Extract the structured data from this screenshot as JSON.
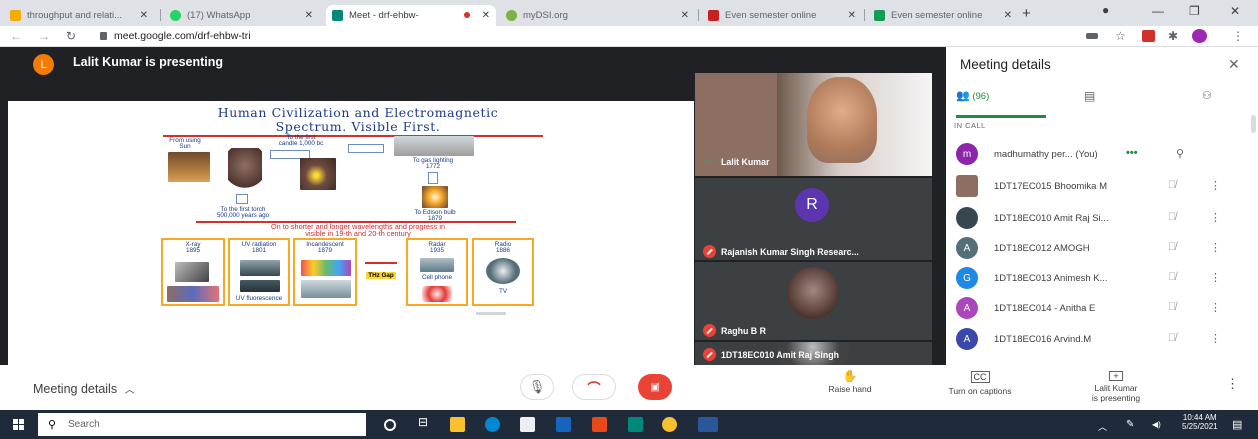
{
  "browser": {
    "tabs": [
      {
        "title": "throughput and relati...",
        "fav_color": "#f9ab00"
      },
      {
        "title": "(17) WhatsApp",
        "fav_color": "#25d366"
      },
      {
        "title": "Meet - drf-ehbw-",
        "fav_color": "#00897b"
      },
      {
        "title": "myDSI.org",
        "fav_color": "#7cb342"
      },
      {
        "title": "Even semester online",
        "fav_color": "#c5221f"
      },
      {
        "title": "Even semester online",
        "fav_color": "#0f9d58"
      }
    ],
    "url": "meet.google.com/drf-ehbw-tri"
  },
  "meet": {
    "presenter_initial": "L",
    "presenting_text": "Lalit Kumar is presenting"
  },
  "slide": {
    "title_line1": "Human Civilization and Electromagnetic",
    "title_line2": "Spectrum. Visible First.",
    "from_using": "From using",
    "sun": "Sun",
    "to_first_candle": "To the first",
    "candle_year": "candle 1,000 bc",
    "gas_lighting": "To gas lighting",
    "gas_year": "1772",
    "first_torch": "To the first torch",
    "torch_year": "500,000 years ago",
    "edison": "To Edison bulb",
    "edison_year": "1879",
    "wave_line1": "On to shorter and longer wavelengths and progress in",
    "wave_line2": "visible in 19-th and 20-th century",
    "box1": [
      "X-ray",
      "1895"
    ],
    "box2": [
      "UV radiation",
      "1801"
    ],
    "box3": [
      "Incandescent",
      "1879"
    ],
    "box4": [
      "Radar",
      "1935"
    ],
    "box5": [
      "Radio",
      "1886"
    ],
    "thz": "THz Gap",
    "cell_phone": "Cell phone",
    "uv_fluor": "UV fluorescence",
    "tv": "TV"
  },
  "tiles": [
    {
      "name": "Lalit Kumar",
      "speaking": true
    },
    {
      "name": "Rajanish Kumar Singh Researc...",
      "initial": "R",
      "avatar_color": "#5e35b1"
    },
    {
      "name": "Raghu B R"
    },
    {
      "name": "1DT18EC010 Amit Raj Singh"
    }
  ],
  "panel": {
    "title": "Meeting details",
    "people_count": "(96)",
    "in_call_label": "IN CALL",
    "participants": [
      {
        "initial": "m",
        "name": "madhumathy per... (You)",
        "color": "#8e24aa",
        "you": true
      },
      {
        "initial": "",
        "name": "1DT17EC015 Bhoomika M",
        "color": "#8d6e63"
      },
      {
        "initial": "",
        "name": "1DT18EC010 Amit Raj Si...",
        "color": "#37474f"
      },
      {
        "initial": "A",
        "name": "1DT18EC012 AMOGH",
        "color": "#546e7a"
      },
      {
        "initial": "G",
        "name": "1DT18EC013 Animesh K...",
        "color": "#1e88e5"
      },
      {
        "initial": "A",
        "name": "1DT18EC014 - Anitha E",
        "color": "#ab47bc"
      },
      {
        "initial": "A",
        "name": "1DT18EC016 Arvind.M",
        "color": "#3949ab"
      }
    ]
  },
  "bottombar": {
    "meeting_details": "Meeting details",
    "raise_hand": "Raise hand",
    "captions": "Turn on captions",
    "presenting_line1": "Lalit Kumar",
    "presenting_line2": "is presenting"
  },
  "taskbar": {
    "search": "Search",
    "time": "10:44 AM",
    "date": "5/25/2021"
  },
  "colors": {
    "meet_bg": "#202124",
    "accent_green": "#1e8e3e",
    "hangup_red": "#ea4335"
  }
}
